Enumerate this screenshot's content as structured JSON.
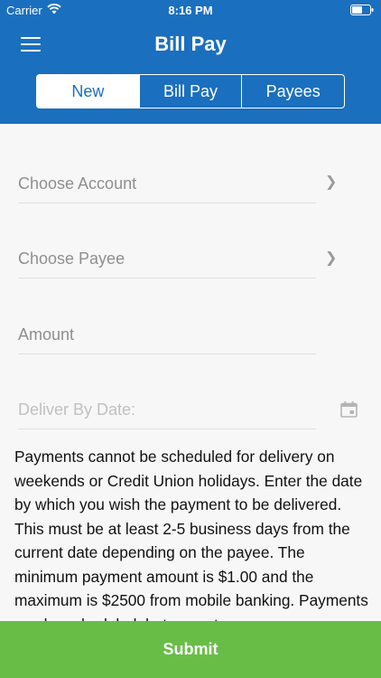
{
  "status": {
    "carrier": "Carrier",
    "time": "8:16 PM"
  },
  "header": {
    "title": "Bill Pay",
    "menu_icon": "hamburger-menu-icon"
  },
  "tabs": [
    {
      "label": "New",
      "active": true
    },
    {
      "label": "Bill Pay",
      "active": false
    },
    {
      "label": "Payees",
      "active": false
    }
  ],
  "form": {
    "account_placeholder": "Choose Account",
    "payee_placeholder": "Choose Payee",
    "amount_placeholder": "Amount",
    "date_placeholder": "Deliver By Date:"
  },
  "info_text": "Payments cannot be scheduled for delivery on weekends or Credit Union holidays. Enter the date by which you wish the payment to be delivered. This must be at least 2-5 business days from the current date depending on the payee. The minimum payment amount is $1.00 and the maximum is $2500 from mobile banking. Payments can be scheduled, but cannot",
  "submit_label": "Submit",
  "colors": {
    "header": "#1b6fbf",
    "submit": "#68bd47"
  }
}
